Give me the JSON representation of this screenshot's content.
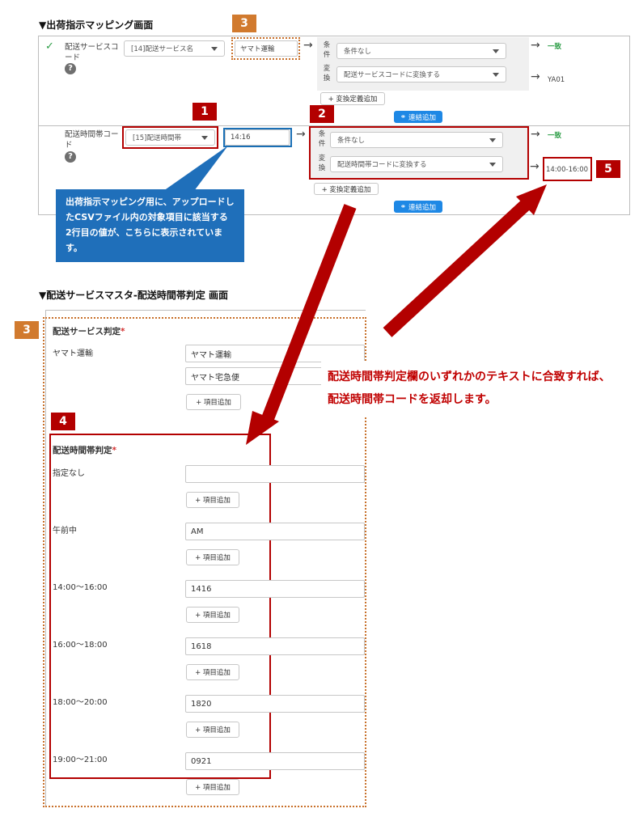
{
  "mapping": {
    "section_title": "▼出荷指示マッピング画面",
    "row1": {
      "field_label": "配送サービスコード",
      "field_select": "[14]配送サービス名",
      "value": "ヤマト運輸",
      "condition_label": "条件",
      "condition_select": "条件なし",
      "convert_label": "変換",
      "convert_select": "配送サービスコードに変換する",
      "match": "一致",
      "result": "YA01",
      "add_conversion": "+ 変換定義追加",
      "add_link": "連結追加"
    },
    "row2": {
      "field_label": "配送時間帯コード",
      "field_select": "[15]配送時間帯",
      "value": "14:16",
      "condition_label": "条件",
      "condition_select": "条件なし",
      "convert_label": "変換",
      "convert_select": "配送時間帯コードに変換する",
      "match": "一致",
      "result": "14:00-16:00",
      "add_conversion": "+ 変換定義追加",
      "add_link": "連結追加"
    }
  },
  "badges": {
    "one": "1",
    "two": "2",
    "three": "3",
    "four": "4",
    "five": "5"
  },
  "callout": {
    "line1": "出荷指示マッピング用に、アップロードし",
    "line2": "たCSVファイル内の対象項目に該当する",
    "line3": "2行目の値が、こちらに表示されています。"
  },
  "note": {
    "line1": "配送時間帯判定欄のいずれかのテキストに合致すれば、",
    "line2": "配送時間帯コードを返却します。"
  },
  "master": {
    "section_title": "▼配送サービスマスタ-配送時間帯判定 画面",
    "service_heading": "配送サービス判定",
    "required_mark": "*",
    "service_name": "ヤマト運輸",
    "service_values": [
      "ヤマト運輸",
      "ヤマト宅急便"
    ],
    "add_item": "+ 項目追加",
    "time_heading": "配送時間帯判定",
    "time_rows": [
      {
        "label": "指定なし",
        "value": ""
      },
      {
        "label": "午前中",
        "value": "AM"
      },
      {
        "label": "14:00～16:00",
        "value": "1416"
      },
      {
        "label": "16:00～18:00",
        "value": "1618"
      },
      {
        "label": "18:00～20:00",
        "value": "1820"
      },
      {
        "label": "19:00～21:00",
        "value": "0921"
      }
    ]
  },
  "colors": {
    "annotation_red": "#b30000",
    "annotation_orange": "#d17a2e",
    "callout_blue": "#1f6fba",
    "link_blue": "#1e88e5",
    "match_green": "#2e9e48"
  }
}
